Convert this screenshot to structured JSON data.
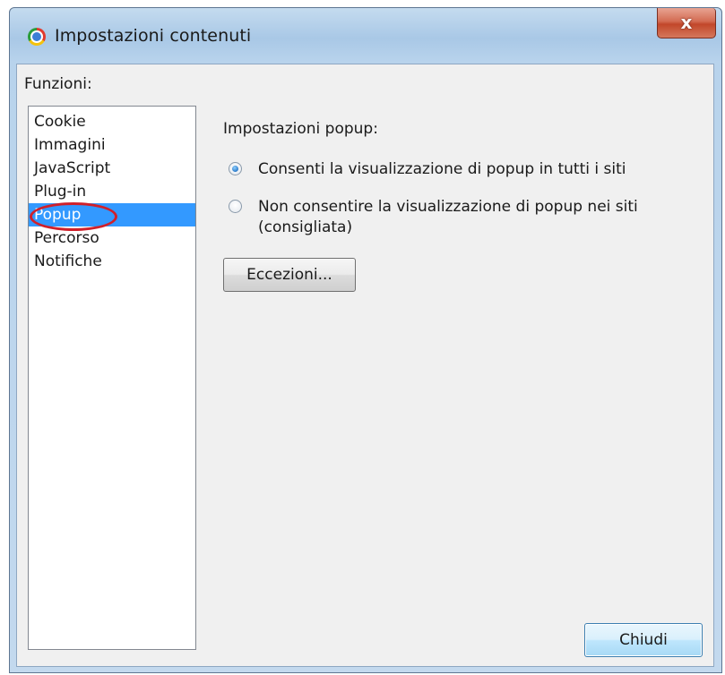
{
  "window": {
    "title": "Impostazioni contenuti",
    "app_icon": "chrome-icon",
    "close_symbol": "x"
  },
  "sidebar": {
    "label": "Funzioni:",
    "items": [
      {
        "label": "Cookie",
        "selected": false
      },
      {
        "label": "Immagini",
        "selected": false
      },
      {
        "label": "JavaScript",
        "selected": false
      },
      {
        "label": "Plug-in",
        "selected": false
      },
      {
        "label": "Popup",
        "selected": true
      },
      {
        "label": "Percorso",
        "selected": false
      },
      {
        "label": "Notifiche",
        "selected": false
      }
    ],
    "highlight_color": "#d0202a",
    "selection_color": "#3399ff"
  },
  "main": {
    "heading": "Impostazioni popup:",
    "options": [
      {
        "label": "Consenti la visualizzazione di popup in tutti i siti",
        "checked": true
      },
      {
        "label_line1": "Non consentire la visualizzazione di popup nei siti",
        "label_line2": "(consigliata)",
        "checked": false
      }
    ],
    "exceptions_button": "Eccezioni..."
  },
  "footer": {
    "close_button": "Chiudi"
  }
}
